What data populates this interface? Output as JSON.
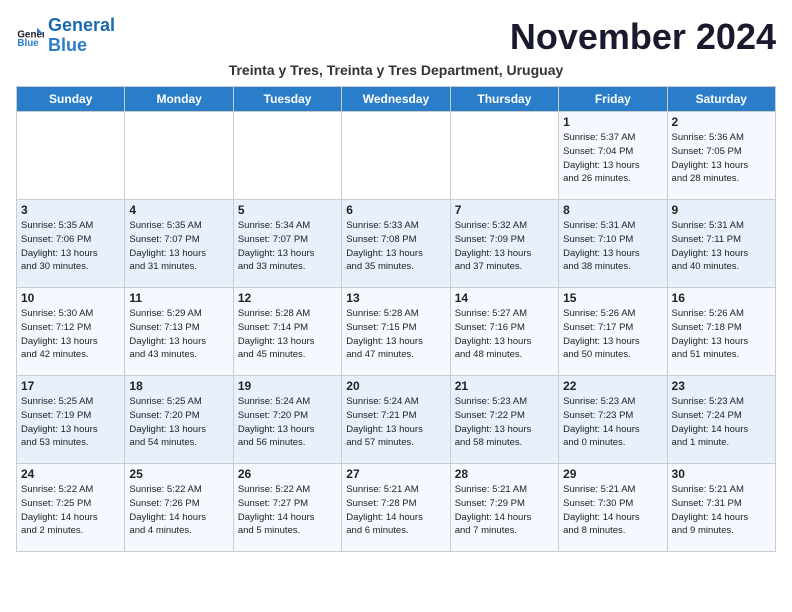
{
  "logo": {
    "line1": "General",
    "line2": "Blue"
  },
  "title": "November 2024",
  "subtitle": "Treinta y Tres, Treinta y Tres Department, Uruguay",
  "days_header": [
    "Sunday",
    "Monday",
    "Tuesday",
    "Wednesday",
    "Thursday",
    "Friday",
    "Saturday"
  ],
  "weeks": [
    [
      {
        "day": "",
        "info": ""
      },
      {
        "day": "",
        "info": ""
      },
      {
        "day": "",
        "info": ""
      },
      {
        "day": "",
        "info": ""
      },
      {
        "day": "",
        "info": ""
      },
      {
        "day": "1",
        "info": "Sunrise: 5:37 AM\nSunset: 7:04 PM\nDaylight: 13 hours\nand 26 minutes."
      },
      {
        "day": "2",
        "info": "Sunrise: 5:36 AM\nSunset: 7:05 PM\nDaylight: 13 hours\nand 28 minutes."
      }
    ],
    [
      {
        "day": "3",
        "info": "Sunrise: 5:35 AM\nSunset: 7:06 PM\nDaylight: 13 hours\nand 30 minutes."
      },
      {
        "day": "4",
        "info": "Sunrise: 5:35 AM\nSunset: 7:07 PM\nDaylight: 13 hours\nand 31 minutes."
      },
      {
        "day": "5",
        "info": "Sunrise: 5:34 AM\nSunset: 7:07 PM\nDaylight: 13 hours\nand 33 minutes."
      },
      {
        "day": "6",
        "info": "Sunrise: 5:33 AM\nSunset: 7:08 PM\nDaylight: 13 hours\nand 35 minutes."
      },
      {
        "day": "7",
        "info": "Sunrise: 5:32 AM\nSunset: 7:09 PM\nDaylight: 13 hours\nand 37 minutes."
      },
      {
        "day": "8",
        "info": "Sunrise: 5:31 AM\nSunset: 7:10 PM\nDaylight: 13 hours\nand 38 minutes."
      },
      {
        "day": "9",
        "info": "Sunrise: 5:31 AM\nSunset: 7:11 PM\nDaylight: 13 hours\nand 40 minutes."
      }
    ],
    [
      {
        "day": "10",
        "info": "Sunrise: 5:30 AM\nSunset: 7:12 PM\nDaylight: 13 hours\nand 42 minutes."
      },
      {
        "day": "11",
        "info": "Sunrise: 5:29 AM\nSunset: 7:13 PM\nDaylight: 13 hours\nand 43 minutes."
      },
      {
        "day": "12",
        "info": "Sunrise: 5:28 AM\nSunset: 7:14 PM\nDaylight: 13 hours\nand 45 minutes."
      },
      {
        "day": "13",
        "info": "Sunrise: 5:28 AM\nSunset: 7:15 PM\nDaylight: 13 hours\nand 47 minutes."
      },
      {
        "day": "14",
        "info": "Sunrise: 5:27 AM\nSunset: 7:16 PM\nDaylight: 13 hours\nand 48 minutes."
      },
      {
        "day": "15",
        "info": "Sunrise: 5:26 AM\nSunset: 7:17 PM\nDaylight: 13 hours\nand 50 minutes."
      },
      {
        "day": "16",
        "info": "Sunrise: 5:26 AM\nSunset: 7:18 PM\nDaylight: 13 hours\nand 51 minutes."
      }
    ],
    [
      {
        "day": "17",
        "info": "Sunrise: 5:25 AM\nSunset: 7:19 PM\nDaylight: 13 hours\nand 53 minutes."
      },
      {
        "day": "18",
        "info": "Sunrise: 5:25 AM\nSunset: 7:20 PM\nDaylight: 13 hours\nand 54 minutes."
      },
      {
        "day": "19",
        "info": "Sunrise: 5:24 AM\nSunset: 7:20 PM\nDaylight: 13 hours\nand 56 minutes."
      },
      {
        "day": "20",
        "info": "Sunrise: 5:24 AM\nSunset: 7:21 PM\nDaylight: 13 hours\nand 57 minutes."
      },
      {
        "day": "21",
        "info": "Sunrise: 5:23 AM\nSunset: 7:22 PM\nDaylight: 13 hours\nand 58 minutes."
      },
      {
        "day": "22",
        "info": "Sunrise: 5:23 AM\nSunset: 7:23 PM\nDaylight: 14 hours\nand 0 minutes."
      },
      {
        "day": "23",
        "info": "Sunrise: 5:23 AM\nSunset: 7:24 PM\nDaylight: 14 hours\nand 1 minute."
      }
    ],
    [
      {
        "day": "24",
        "info": "Sunrise: 5:22 AM\nSunset: 7:25 PM\nDaylight: 14 hours\nand 2 minutes."
      },
      {
        "day": "25",
        "info": "Sunrise: 5:22 AM\nSunset: 7:26 PM\nDaylight: 14 hours\nand 4 minutes."
      },
      {
        "day": "26",
        "info": "Sunrise: 5:22 AM\nSunset: 7:27 PM\nDaylight: 14 hours\nand 5 minutes."
      },
      {
        "day": "27",
        "info": "Sunrise: 5:21 AM\nSunset: 7:28 PM\nDaylight: 14 hours\nand 6 minutes."
      },
      {
        "day": "28",
        "info": "Sunrise: 5:21 AM\nSunset: 7:29 PM\nDaylight: 14 hours\nand 7 minutes."
      },
      {
        "day": "29",
        "info": "Sunrise: 5:21 AM\nSunset: 7:30 PM\nDaylight: 14 hours\nand 8 minutes."
      },
      {
        "day": "30",
        "info": "Sunrise: 5:21 AM\nSunset: 7:31 PM\nDaylight: 14 hours\nand 9 minutes."
      }
    ]
  ]
}
